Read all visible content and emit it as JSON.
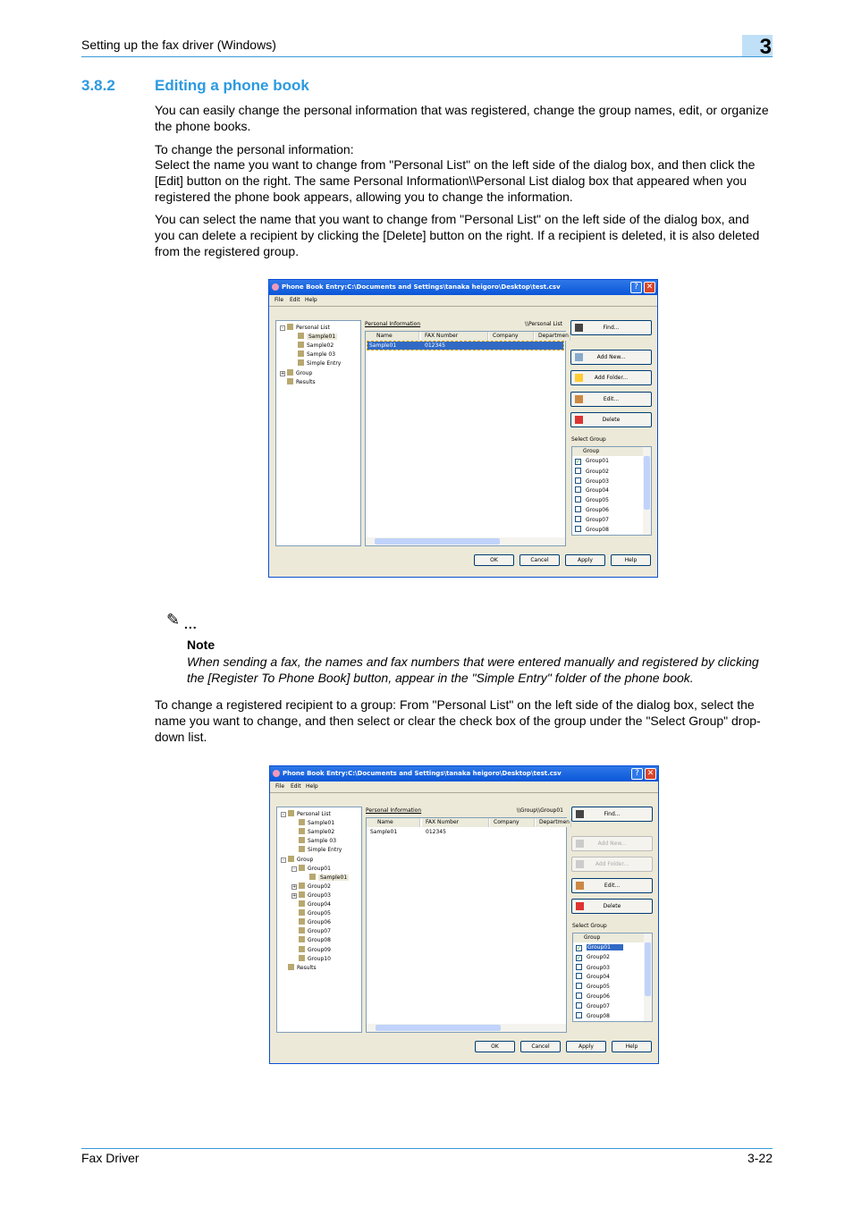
{
  "header": {
    "title": "Setting up the fax driver (Windows)",
    "chapter": "3"
  },
  "section": {
    "number": "3.8.2",
    "title": "Editing a phone book"
  },
  "paragraphs": {
    "p1": "You can easily change the personal information that was registered, change the group names, edit, or organize the phone books.",
    "p2a": "To change the personal information:",
    "p2b": "Select the name you want to change from \"Personal List\" on the left side of the dialog box, and then click the [Edit] button on the right. The same Personal Information\\\\Personal List dialog box that appeared when you registered the phone book appears, allowing you to change the information.",
    "p3": "You can select the name that you want to change from \"Personal List\" on the left side of the dialog box, and you can delete a recipient by clicking the [Delete] button on the right. If a recipient is deleted, it is also deleted from the registered group.",
    "p4": "To change a registered recipient to a group: From \"Personal List\" on the left side of the dialog box, select the name you want to change, and then select or clear the check box of the group under the \"Select Group\" drop-down list."
  },
  "note": {
    "icon": "pencil-note-icon",
    "dots": "...",
    "label": "Note",
    "text": "When sending a fax, the names and fax numbers that were entered manually and registered by clicking the [Register To Phone Book] button, appear in the \"Simple Entry\" folder of the phone book."
  },
  "footer": {
    "left": "Fax Driver",
    "right": "3-22"
  },
  "dialogs": [
    {
      "title": "Phone Book Entry:C:\\Documents and Settings\\tanaka heigoro\\Desktop\\test.csv",
      "menu": [
        "File",
        "Edit",
        "Help"
      ],
      "tree": [
        {
          "label": "Personal List",
          "level": 0,
          "exp": "-"
        },
        {
          "label": "Sample01",
          "level": 1,
          "sel": true
        },
        {
          "label": "Sample02",
          "level": 1
        },
        {
          "label": "Sample 03",
          "level": 1
        },
        {
          "label": "Simple Entry",
          "level": 1
        },
        {
          "label": "Group",
          "level": 0,
          "exp": "+"
        },
        {
          "label": "Results",
          "level": 0
        }
      ],
      "info_label": "Personal Information",
      "path": "\\\\Personal List",
      "columns": [
        "Name",
        "FAX Number",
        "Company",
        "Departmen"
      ],
      "rows": [
        {
          "name": "Sample01",
          "fax": "012345",
          "selected": true
        }
      ],
      "buttons": [
        {
          "label": "Find...",
          "enabled": true
        },
        {
          "label": "Add New...",
          "enabled": true
        },
        {
          "label": "Add Folder...",
          "enabled": true
        },
        {
          "label": "Edit...",
          "enabled": true
        },
        {
          "label": "Delete",
          "enabled": true
        }
      ],
      "select_group_label": "Select Group",
      "group_header": "Group",
      "groups": [
        {
          "label": "Group01",
          "checked": true
        },
        {
          "label": "Group02"
        },
        {
          "label": "Group03"
        },
        {
          "label": "Group04"
        },
        {
          "label": "Group05"
        },
        {
          "label": "Group06"
        },
        {
          "label": "Group07"
        },
        {
          "label": "Group08"
        }
      ],
      "footer_buttons": [
        "OK",
        "Cancel",
        "Apply",
        "Help"
      ]
    },
    {
      "title": "Phone Book Entry:C:\\Documents and Settings\\tanaka heigoro\\Desktop\\test.csv",
      "menu": [
        "File",
        "Edit",
        "Help"
      ],
      "tree": [
        {
          "label": "Personal List",
          "level": 0,
          "exp": "-"
        },
        {
          "label": "Sample01",
          "level": 1
        },
        {
          "label": "Sample02",
          "level": 1
        },
        {
          "label": "Sample 03",
          "level": 1
        },
        {
          "label": "Simple Entry",
          "level": 1
        },
        {
          "label": "Group",
          "level": 0,
          "exp": "-"
        },
        {
          "label": "Group01",
          "level": 1,
          "exp": "-"
        },
        {
          "label": "Sample01",
          "level": 2,
          "sel": true
        },
        {
          "label": "Group02",
          "level": 1,
          "exp": "+"
        },
        {
          "label": "Group03",
          "level": 1,
          "exp": "+"
        },
        {
          "label": "Group04",
          "level": 1
        },
        {
          "label": "Group05",
          "level": 1
        },
        {
          "label": "Group06",
          "level": 1
        },
        {
          "label": "Group07",
          "level": 1
        },
        {
          "label": "Group08",
          "level": 1
        },
        {
          "label": "Group09",
          "level": 1
        },
        {
          "label": "Group10",
          "level": 1
        },
        {
          "label": "Results",
          "level": 0
        }
      ],
      "info_label": "Personal Information",
      "path": "\\\\Group\\\\Group01",
      "columns": [
        "Name",
        "FAX Number",
        "Company",
        "Departmen"
      ],
      "rows": [
        {
          "name": "Sample01",
          "fax": "012345",
          "selected": false
        }
      ],
      "buttons": [
        {
          "label": "Find...",
          "enabled": true
        },
        {
          "label": "Add New...",
          "enabled": false
        },
        {
          "label": "Add Folder...",
          "enabled": false
        },
        {
          "label": "Edit...",
          "enabled": true
        },
        {
          "label": "Delete",
          "enabled": true
        }
      ],
      "select_group_label": "Select Group",
      "group_header": "Group",
      "groups": [
        {
          "label": "Group01",
          "checked": true,
          "highlighted": true
        },
        {
          "label": "Group02",
          "checked": true
        },
        {
          "label": "Group03"
        },
        {
          "label": "Group04"
        },
        {
          "label": "Group05"
        },
        {
          "label": "Group06"
        },
        {
          "label": "Group07"
        },
        {
          "label": "Group08"
        }
      ],
      "footer_buttons": [
        "OK",
        "Cancel",
        "Apply",
        "Help"
      ]
    }
  ]
}
